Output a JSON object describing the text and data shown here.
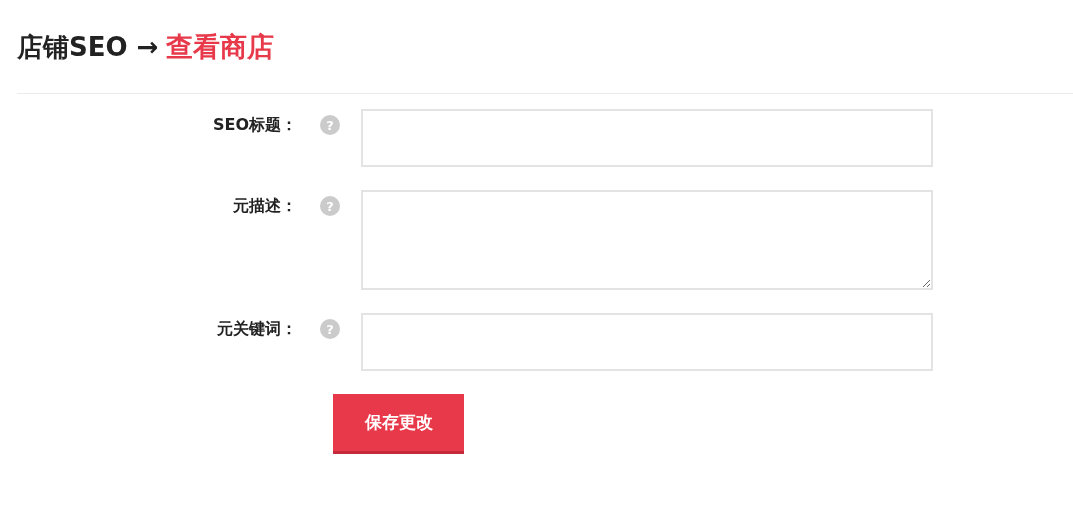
{
  "header": {
    "title": "店铺SEO →",
    "link": "查看商店"
  },
  "fields": [
    {
      "label": "SEO标题：",
      "help": "?",
      "kind": "input"
    },
    {
      "label": "元描述：",
      "help": "?",
      "kind": "textarea"
    },
    {
      "label": "元关键词：",
      "help": "?",
      "kind": "input"
    }
  ],
  "save_button": "保存更改"
}
